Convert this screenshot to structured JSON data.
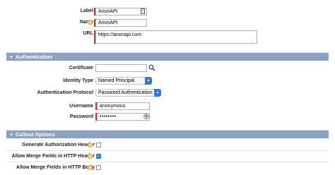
{
  "fields": {
    "label": {
      "label": "Label",
      "value": "AnonAPI"
    },
    "name": {
      "label": "Name",
      "value": "AnonAPI"
    },
    "url": {
      "label": "URL",
      "value": "https://anonapi.com"
    }
  },
  "authentication": {
    "title": "Authentication",
    "certificate": {
      "label": "Certificate",
      "value": ""
    },
    "identity_type": {
      "label": "Identity Type",
      "value": "Named Principal"
    },
    "auth_protocol": {
      "label": "Authentication Protocol",
      "value": "Password Authentication"
    },
    "username": {
      "label": "Username",
      "value": "anonymous"
    },
    "password": {
      "label": "Password",
      "value": "••••••••"
    }
  },
  "callout": {
    "title": "Callout Options",
    "options": [
      {
        "label": "Generate Authorization Header",
        "checked": false
      },
      {
        "label": "Allow Merge Fields in HTTP Header",
        "checked": true
      },
      {
        "label": "Allow Merge Fields in HTTP Body",
        "checked": false
      }
    ]
  },
  "colors": {
    "section_header": "#8ba2c2",
    "required": "#c23934",
    "accent": "#2e7bd6"
  }
}
